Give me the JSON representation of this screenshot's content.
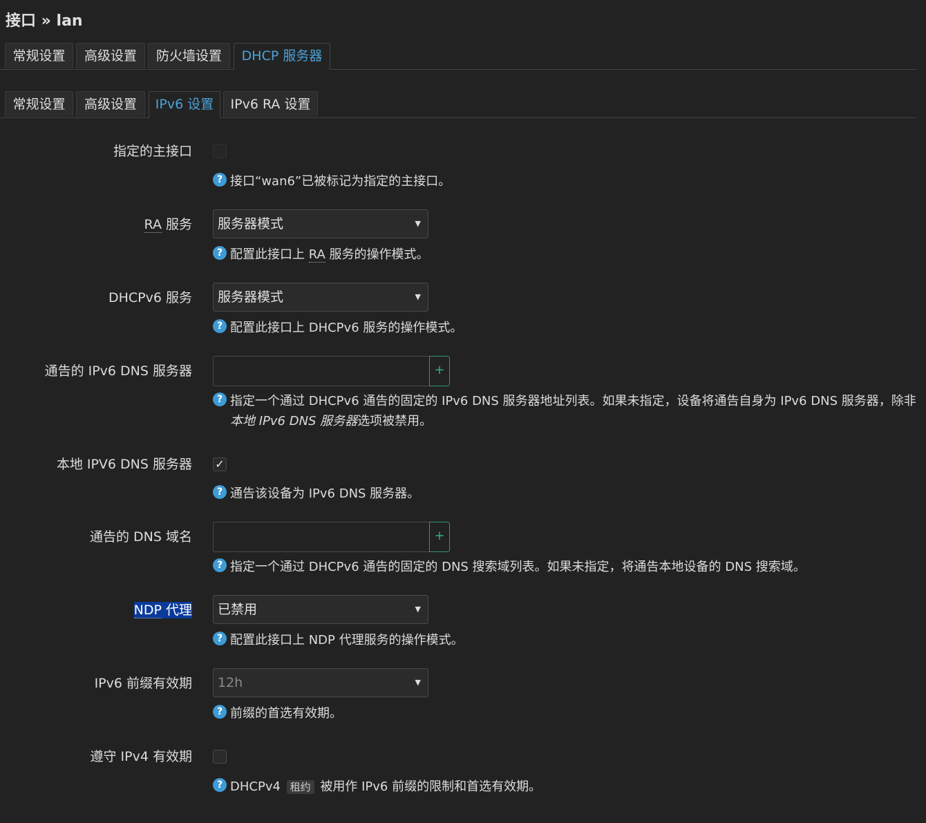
{
  "page": {
    "title": "接口 » lan"
  },
  "top_tabs": [
    {
      "label": "常规设置"
    },
    {
      "label": "高级设置"
    },
    {
      "label": "防火墙设置"
    },
    {
      "label": "DHCP 服务器"
    }
  ],
  "sub_tabs": [
    {
      "label": "常规设置"
    },
    {
      "label": "高级设置"
    },
    {
      "label": "IPv6 设置"
    },
    {
      "label": "IPv6 RA 设置"
    }
  ],
  "fields": {
    "master": {
      "label": "指定的主接口",
      "checked": false,
      "help": "接口“wan6”已被标记为指定的主接口。"
    },
    "ra": {
      "label_abbr": "RA",
      "label_rest": " 服务",
      "value": "服务器模式",
      "help_pre": "配置此接口上 ",
      "help_abbr": "RA",
      "help_post": " 服务的操作模式。"
    },
    "dhcpv6": {
      "label": "DHCPv6 服务",
      "value": "服务器模式",
      "help": "配置此接口上 DHCPv6 服务的操作模式。"
    },
    "dns_servers": {
      "label": "通告的 IPv6 DNS 服务器",
      "value": "",
      "add": "+",
      "help_pre": "指定一个通过 DHCPv6 通告的固定的 IPv6 DNS 服务器地址列表。如果未指定，设备将通告自身为 IPv6 DNS 服务器，除非",
      "help_em": "本地 IPv6 DNS 服务器",
      "help_post": "选项被禁用。"
    },
    "local_dns": {
      "label": "本地 IPV6 DNS 服务器",
      "checked": true,
      "check_glyph": "✓",
      "help": "通告该设备为 IPv6 DNS 服务器。"
    },
    "dns_domains": {
      "label": "通告的 DNS 域名",
      "value": "",
      "add": "+",
      "help": "指定一个通过 DHCPv6 通告的固定的 DNS 搜索域列表。如果未指定，将通告本地设备的 DNS 搜索域。"
    },
    "ndp": {
      "label_abbr": "NDP",
      "label_rest": " 代理",
      "value": "已禁用",
      "help": "配置此接口上 NDP 代理服务的操作模式。"
    },
    "prefix_lifetime": {
      "label": "IPv6 前缀有效期",
      "value": "12h",
      "help": "前缀的首选有效期。"
    },
    "ipv4_lifetime": {
      "label": "遵守 IPv4 有效期",
      "checked": false,
      "help_pre": "DHCPv4 ",
      "help_badge": "租约",
      "help_post": " 被用作 IPv6 前缀的限制和首选有效期。"
    }
  },
  "icons": {
    "help": "?",
    "caret": "▼"
  },
  "colors": {
    "background": "#222222",
    "accent": "#4aa3d8",
    "add_button": "#33b07a",
    "selection": "#0b3b9a"
  }
}
